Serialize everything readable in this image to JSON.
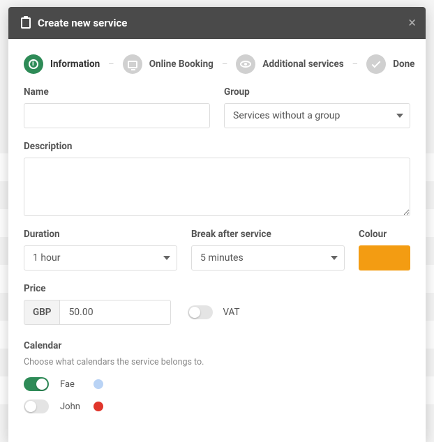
{
  "header": {
    "title": "Create new service"
  },
  "stepper": {
    "steps": [
      {
        "label": "Information",
        "active": true,
        "icon": "info"
      },
      {
        "label": "Online Booking",
        "active": false,
        "icon": "monitor"
      },
      {
        "label": "Additional services",
        "active": false,
        "icon": "eye"
      },
      {
        "label": "Done",
        "active": false,
        "icon": "check"
      }
    ]
  },
  "fields": {
    "name": {
      "label": "Name",
      "value": ""
    },
    "group": {
      "label": "Group",
      "selected": "Services without a group"
    },
    "description": {
      "label": "Description",
      "value": ""
    },
    "duration": {
      "label": "Duration",
      "selected": "1 hour"
    },
    "break_after": {
      "label": "Break after service",
      "selected": "5 minutes"
    },
    "colour": {
      "label": "Colour",
      "hex": "#f39c12"
    },
    "price": {
      "label": "Price",
      "currency": "GBP",
      "value": "50.00"
    },
    "vat": {
      "label": "VAT",
      "on": false
    },
    "calendar": {
      "label": "Calendar",
      "hint": "Choose what calendars the service belongs to.",
      "items": [
        {
          "name": "Fae",
          "on": true,
          "dot": "#b9d3f5"
        },
        {
          "name": "John",
          "on": false,
          "dot": "#e0352b"
        }
      ]
    }
  }
}
